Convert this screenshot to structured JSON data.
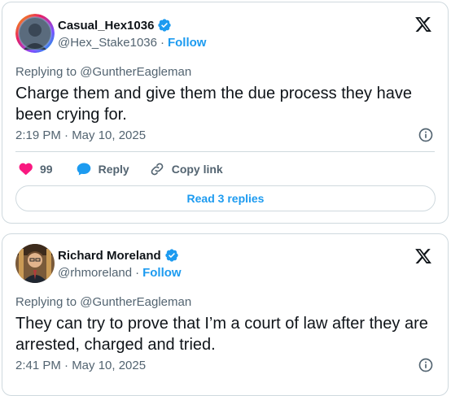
{
  "tweets": [
    {
      "display_name": "Casual_Hex1036",
      "handle": "@Hex_Stake1036",
      "follow_label": "Follow",
      "replying_to": "Replying to @GuntherEagleman",
      "text": "Charge them and give them the due process they have been crying for.",
      "timestamp": "2:19 PM · May 10, 2025",
      "likes": "99",
      "reply_label": "Reply",
      "copy_link_label": "Copy link",
      "read_replies_label": "Read 3 replies"
    },
    {
      "display_name": "Richard Moreland",
      "handle": "@rhmoreland",
      "follow_label": "Follow",
      "replying_to": "Replying to @GuntherEagleman",
      "text": "They can try to prove that I’m a court of law after they are arrested, charged and tried.",
      "timestamp": "2:41 PM · May 10, 2025"
    }
  ],
  "colors": {
    "accent": "#1d9bf0",
    "like": "#f91880",
    "secondary_text": "#536471",
    "border": "#cfd9de"
  },
  "icons": [
    "verified-badge-icon",
    "x-logo-icon",
    "info-icon",
    "heart-icon",
    "reply-bubble-icon",
    "link-icon"
  ]
}
